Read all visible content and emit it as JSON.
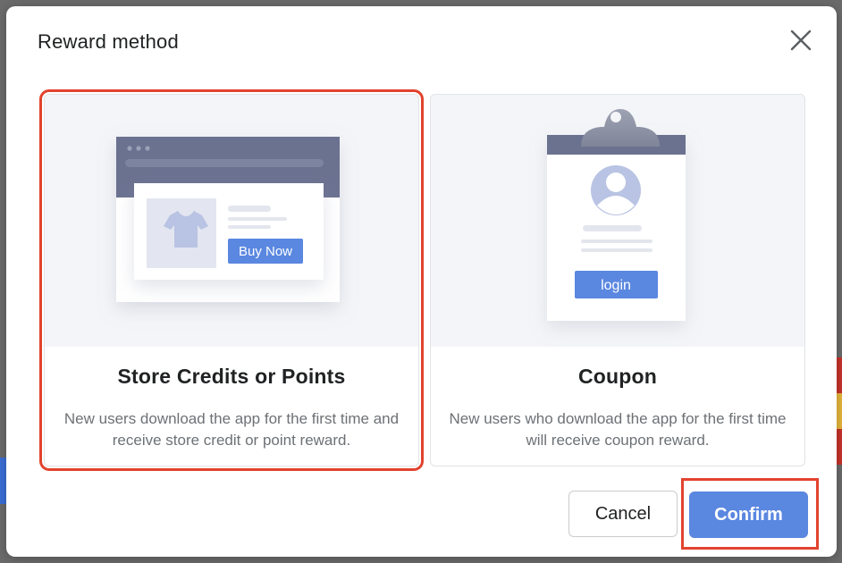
{
  "modal": {
    "title": "Reward method",
    "close_icon": "close-icon"
  },
  "options": [
    {
      "id": "store-credits",
      "title": "Store Credits or Points",
      "description": "New users download the app for the first time and receive store credit or point reward.",
      "illustration": {
        "button_label": "Buy Now",
        "icon": "tshirt-icon"
      },
      "selected": true
    },
    {
      "id": "coupon",
      "title": "Coupon",
      "description": "New users who download the app for the first time will receive coupon reward.",
      "illustration": {
        "button_label": "login",
        "icon": "user-avatar-icon"
      },
      "selected": false
    }
  ],
  "footer": {
    "cancel_label": "Cancel",
    "confirm_label": "Confirm"
  },
  "colors": {
    "primary": "#5a87e0",
    "highlight": "#e2432e",
    "text": "#202223",
    "muted_text": "#6d7175"
  }
}
